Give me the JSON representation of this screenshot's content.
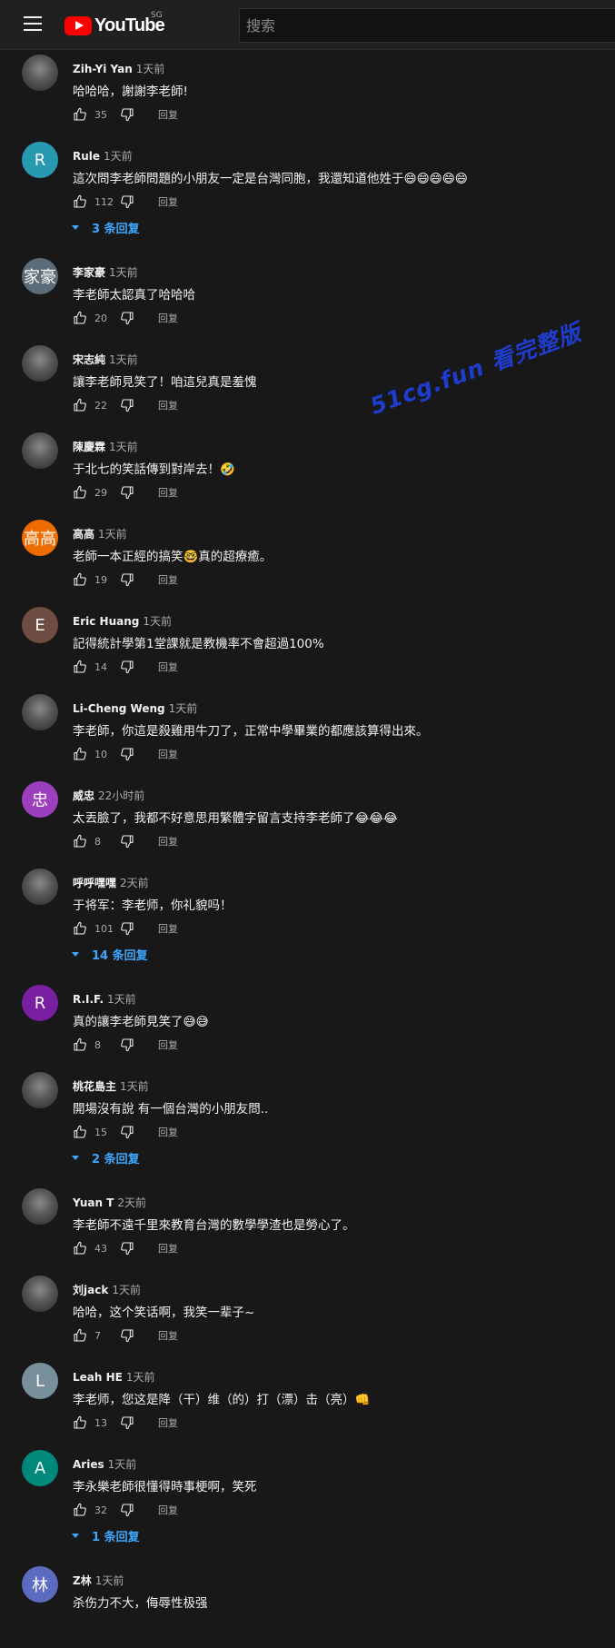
{
  "header": {
    "logo_text": "YouTube",
    "region": "SG",
    "search_placeholder": "搜索"
  },
  "watermark": "51cg.fun 看完整版",
  "colors": {
    "accent_blue": "#3ea6ff",
    "brand_red": "#ff0000",
    "background": "#181818"
  },
  "comments": [
    {
      "author": "Zih-Yi Yan",
      "time": "1天前",
      "text": "哈哈哈，謝謝李老師!",
      "likes": "35",
      "reply": "回复",
      "avatar_letter": "",
      "avatar_color": ""
    },
    {
      "author": "Rule",
      "time": "1天前",
      "text": "這次問李老師問題的小朋友一定是台灣同胞，我還知道他姓于😄😄😄😄😄",
      "likes": "112",
      "reply": "回复",
      "avatar_letter": "R",
      "avatar_color": "#2799b1",
      "replies": "3 条回复"
    },
    {
      "author": "李家豪",
      "time": "1天前",
      "text": "李老師太認真了哈哈哈",
      "likes": "20",
      "reply": "回复",
      "avatar_letter": "家豪",
      "avatar_color": "#5b6b77"
    },
    {
      "author": "宋志純",
      "time": "1天前",
      "text": "讓李老師見笑了！咱這兒真是羞愧",
      "likes": "22",
      "reply": "回复",
      "avatar_letter": "",
      "avatar_color": ""
    },
    {
      "author": "陳慶霖",
      "time": "1天前",
      "text": "于北七的笑話傳到對岸去！🤣",
      "likes": "29",
      "reply": "回复",
      "avatar_letter": "",
      "avatar_color": ""
    },
    {
      "author": "高高",
      "time": "1天前",
      "text": "老師一本正經的搞笑🤓真的超療癒。",
      "likes": "19",
      "reply": "回复",
      "avatar_letter": "高高",
      "avatar_color": "#ef6c00"
    },
    {
      "author": "Eric Huang",
      "time": "1天前",
      "text": "記得統計學第1堂課就是教機率不會超過100%",
      "likes": "14",
      "reply": "回复",
      "avatar_letter": "E",
      "avatar_color": "#6d4c41"
    },
    {
      "author": "Li-Cheng Weng",
      "time": "1天前",
      "text": "李老師，你這是殺雞用牛刀了，正常中學畢業的都應該算得出來。",
      "likes": "10",
      "reply": "回复",
      "avatar_letter": "",
      "avatar_color": ""
    },
    {
      "author": "威忠",
      "time": "22小时前",
      "text": "太丟臉了，我都不好意思用繁體字留言支持李老師了😂😂😂",
      "likes": "8",
      "reply": "回复",
      "avatar_letter": "忠",
      "avatar_color": "#9c3fbf"
    },
    {
      "author": "呼呼嘿嘿",
      "time": "2天前",
      "text": "于将军：李老师，你礼貌吗！",
      "likes": "101",
      "reply": "回复",
      "avatar_letter": "",
      "avatar_color": "",
      "replies": "14 条回复"
    },
    {
      "author": "R.I.F.",
      "time": "1天前",
      "text": "真的讓李老師見笑了😅😅",
      "likes": "8",
      "reply": "回复",
      "avatar_letter": "R",
      "avatar_color": "#7b1fa2"
    },
    {
      "author": "桃花島主",
      "time": "1天前",
      "text": "開場沒有說 有一個台灣的小朋友問..",
      "likes": "15",
      "reply": "回复",
      "avatar_letter": "",
      "avatar_color": "",
      "replies": "2 条回复"
    },
    {
      "author": "Yuan T",
      "time": "2天前",
      "text": "李老師不遠千里來教育台灣的數學學渣也是勞心了。",
      "likes": "43",
      "reply": "回复",
      "avatar_letter": "",
      "avatar_color": ""
    },
    {
      "author": "刘jack",
      "time": "1天前",
      "text": "哈哈，这个笑话啊，我笑一辈子~",
      "likes": "7",
      "reply": "回复",
      "avatar_letter": "",
      "avatar_color": ""
    },
    {
      "author": "Leah HE",
      "time": "1天前",
      "text": "李老师，您这是降（干）维（的）打（漂）击（亮）👊",
      "likes": "13",
      "reply": "回复",
      "avatar_letter": "L",
      "avatar_color": "#78909c"
    },
    {
      "author": "Aries",
      "time": "1天前",
      "text": "李永樂老師很懂得時事梗啊，笑死",
      "likes": "32",
      "reply": "回复",
      "avatar_letter": "A",
      "avatar_color": "#00897b",
      "replies": "1 条回复"
    },
    {
      "author": "Z林",
      "time": "1天前",
      "text": "杀伤力不大，侮辱性极强",
      "likes": "",
      "reply": "",
      "avatar_letter": "林",
      "avatar_color": "#5c6bc0"
    }
  ]
}
